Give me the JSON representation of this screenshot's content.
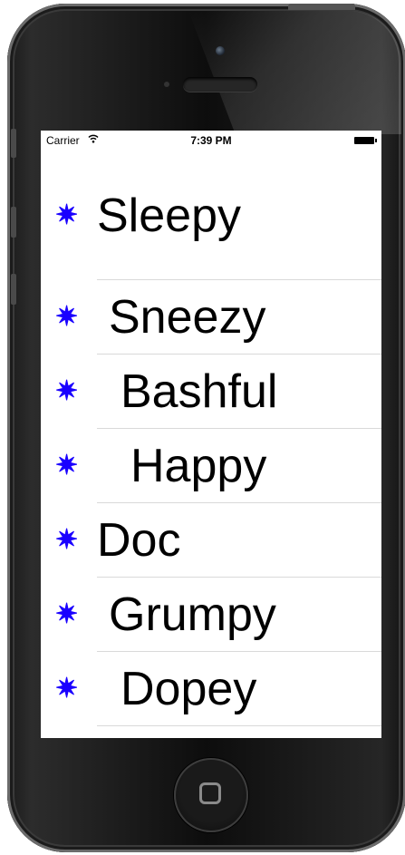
{
  "status_bar": {
    "carrier": "Carrier",
    "time": "7:39 PM"
  },
  "list": {
    "bullet_glyph": "✷",
    "bullet_color": "#1a00ff",
    "items": [
      {
        "label": "Sleepy"
      },
      {
        "label": "Sneezy"
      },
      {
        "label": "Bashful"
      },
      {
        "label": "Happy"
      },
      {
        "label": "Doc"
      },
      {
        "label": "Grumpy"
      },
      {
        "label": "Dopey"
      }
    ]
  }
}
